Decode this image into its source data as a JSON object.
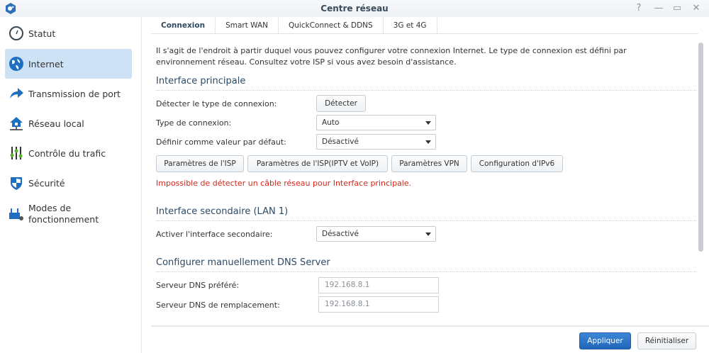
{
  "window": {
    "title": "Centre réseau",
    "help": "?",
    "minimize": "—",
    "maximize": "▭",
    "close": "✕"
  },
  "sidebar": {
    "items": [
      {
        "label": "Statut",
        "icon": "gauge-icon"
      },
      {
        "label": "Internet",
        "icon": "globe-icon"
      },
      {
        "label": "Transmission de port",
        "icon": "arrow-forward-icon"
      },
      {
        "label": "Réseau local",
        "icon": "home-network-icon"
      },
      {
        "label": "Contrôle du trafic",
        "icon": "sliders-icon"
      },
      {
        "label": "Sécurité",
        "icon": "shield-icon"
      },
      {
        "label": "Modes de fonctionnement",
        "icon": "router-gear-icon"
      }
    ],
    "selected": "Internet"
  },
  "tabs": [
    "Connexion",
    "Smart WAN",
    "QuickConnect & DDNS",
    "3G et 4G"
  ],
  "intro": "Il s'agit de l'endroit à partir duquel vous pouvez configurer votre connexion Internet. Le type de connexion est défini par environnement réseau. Consultez votre ISP si vous avez besoin d'assistance.",
  "primary": {
    "heading": "Interface principale",
    "detect_label": "Détecter le type de connexion:",
    "detect_button": "Détecter",
    "type_label": "Type de connexion:",
    "type_value": "Auto",
    "default_label": "Définir comme valeur par défaut:",
    "default_value": "Désactivé",
    "buttons": [
      "Paramètres de l'ISP",
      "Paramètres de l'ISP(IPTV et VoIP)",
      "Paramètres VPN",
      "Configuration d'IPv6"
    ],
    "error": "Impossible de détecter un câble réseau pour Interface principale.",
    "error_color": "#d0281c"
  },
  "secondary": {
    "heading": "Interface secondaire (LAN 1)",
    "enable_label": "Activer l'interface secondaire:",
    "enable_value": "Désactivé"
  },
  "dns": {
    "heading": "Configurer manuellement DNS Server",
    "preferred_label": "Serveur DNS préféré:",
    "preferred_value": "192.168.8.1",
    "alternate_label": "Serveur DNS de remplacement:",
    "alternate_value": "192.168.8.1"
  },
  "footer": {
    "apply": "Appliquer",
    "reset": "Réinitialiser"
  }
}
